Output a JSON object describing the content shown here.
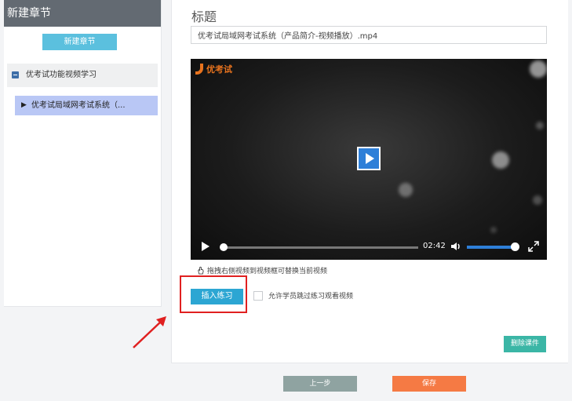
{
  "sidebar": {
    "header_title": "新建章节",
    "new_chapter_button": "新建章节",
    "chapter": {
      "label": "优考试功能视频学习"
    },
    "lesson": {
      "label": "优考试局域网考试系统（..."
    }
  },
  "editor": {
    "title_heading": "标题",
    "title_value": "优考试局域网考试系统（产品简介-视频播放）.mp4",
    "player": {
      "logo_text": "优考试",
      "time": "02:42",
      "progress": 0.0,
      "volume": 0.9
    },
    "hint_text": "拖拽右侧视频到视频框可替换当前视频",
    "insert_button": "插入练习",
    "allow_skip_label": "允许学员跳过练习观看视频",
    "delete_button": "删除课件"
  },
  "footer": {
    "prev_button": "上一步",
    "save_button": "保存"
  },
  "colors": {
    "sidebar_header": "#636a72",
    "accent_blue": "#2ca6d3",
    "delete_green": "#3bb6a6",
    "save_orange": "#f57a44",
    "highlight_red": "#e02020"
  }
}
